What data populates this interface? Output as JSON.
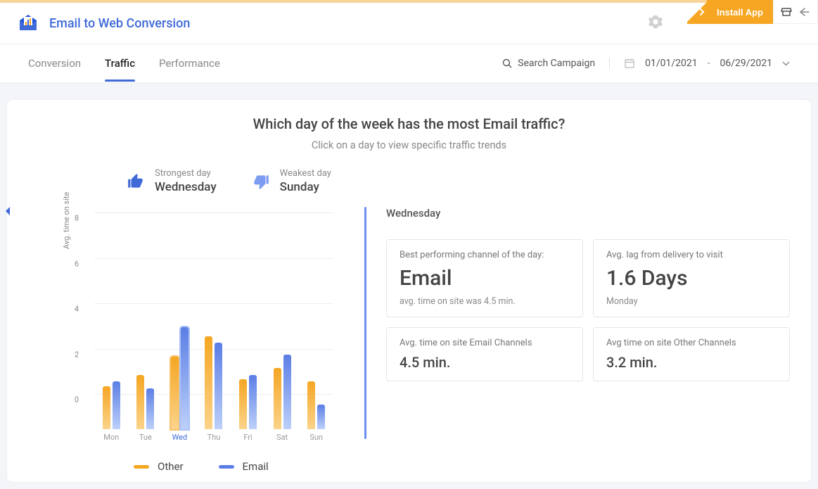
{
  "header": {
    "app_title": "Email to Web Conversion",
    "install_label": "Install App"
  },
  "tabs": {
    "conversion": "Conversion",
    "traffic": "Traffic",
    "performance": "Performance"
  },
  "toolbar": {
    "search_label": "Search Campaign",
    "date_from": "01/01/2021",
    "date_sep": "-",
    "date_to": "06/29/2021"
  },
  "card": {
    "title": "Which day of the week has the most Email traffic?",
    "subtitle": "Click on a day to view specific traffic trends",
    "strongest_label": "Strongest day",
    "strongest_value": "Wednesday",
    "weakest_label": "Weakest day",
    "weakest_value": "Sunday"
  },
  "detail": {
    "day": "Wednesday",
    "m1_label": "Best performing channel of the day:",
    "m1_value": "Email",
    "m1_sub": "avg. time on site was 4.5 min.",
    "m2_label": "Avg. lag from delivery to visit",
    "m2_value": "1.6 Days",
    "m2_sub": "Monday",
    "m3_label": "Avg. time on site Email Channels",
    "m3_value": "4.5 min.",
    "m4_label": "Avg time on site Other Channels",
    "m4_value": "3.2 min."
  },
  "legend": {
    "other": "Other",
    "email": "Email"
  },
  "chart_data": {
    "type": "bar",
    "ylabel": "Avg. time on site",
    "ylim": [
      0,
      8
    ],
    "yticks": [
      0,
      2,
      4,
      6,
      8
    ],
    "categories": [
      "Mon",
      "Tue",
      "Wed",
      "Thu",
      "Fri",
      "Sat",
      "Sun"
    ],
    "series": [
      {
        "name": "Other",
        "values": [
          1.9,
          2.4,
          3.2,
          4.1,
          2.2,
          2.7,
          2.1
        ]
      },
      {
        "name": "Email",
        "values": [
          2.1,
          1.8,
          4.5,
          3.8,
          2.4,
          3.3,
          1.1
        ]
      }
    ],
    "highlight_index": 2
  }
}
